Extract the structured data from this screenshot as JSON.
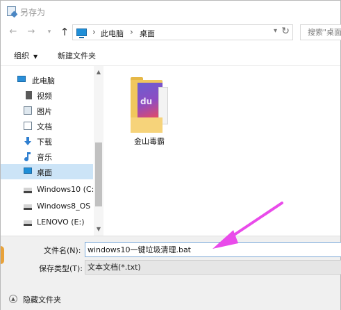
{
  "window": {
    "title": "另存为"
  },
  "nav": {
    "back_icon": "arrow-left-icon",
    "forward_icon": "arrow-right-icon",
    "history_icon": "chevron-down-icon",
    "up_icon": "arrow-up-icon",
    "breadcrumbs": [
      "此电脑",
      "桌面"
    ],
    "refresh_icon": "refresh-icon",
    "search_placeholder": "搜索\"桌面"
  },
  "toolbar": {
    "organize_label": "组织",
    "new_folder_label": "新建文件夹"
  },
  "sidebar": {
    "items": [
      {
        "label": "此电脑",
        "icon": "computer-icon"
      },
      {
        "label": "视频",
        "icon": "video-icon"
      },
      {
        "label": "图片",
        "icon": "pictures-icon"
      },
      {
        "label": "文档",
        "icon": "documents-icon"
      },
      {
        "label": "下载",
        "icon": "download-icon"
      },
      {
        "label": "音乐",
        "icon": "music-icon"
      },
      {
        "label": "桌面",
        "icon": "desktop-icon",
        "selected": true
      },
      {
        "label": "Windows10 (C:",
        "icon": "drive-icon"
      },
      {
        "label": "Windows8_OS",
        "icon": "drive-icon"
      },
      {
        "label": "LENOVO (E:)",
        "icon": "drive-icon"
      }
    ]
  },
  "files": [
    {
      "name": "金山毒霸",
      "icon": "folder-icon"
    }
  ],
  "form": {
    "filename_label": "文件名(N):",
    "filename_value": "windows10一键垃圾清理.bat",
    "filetype_label": "保存类型(T):",
    "filetype_value": "文本文档(*.txt)"
  },
  "footer": {
    "hide_folders_label": "隐藏文件夹"
  },
  "colors": {
    "selection": "#cce4f7",
    "annotation_arrow": "#e94bea",
    "accent_folder": "#f0c75d"
  }
}
